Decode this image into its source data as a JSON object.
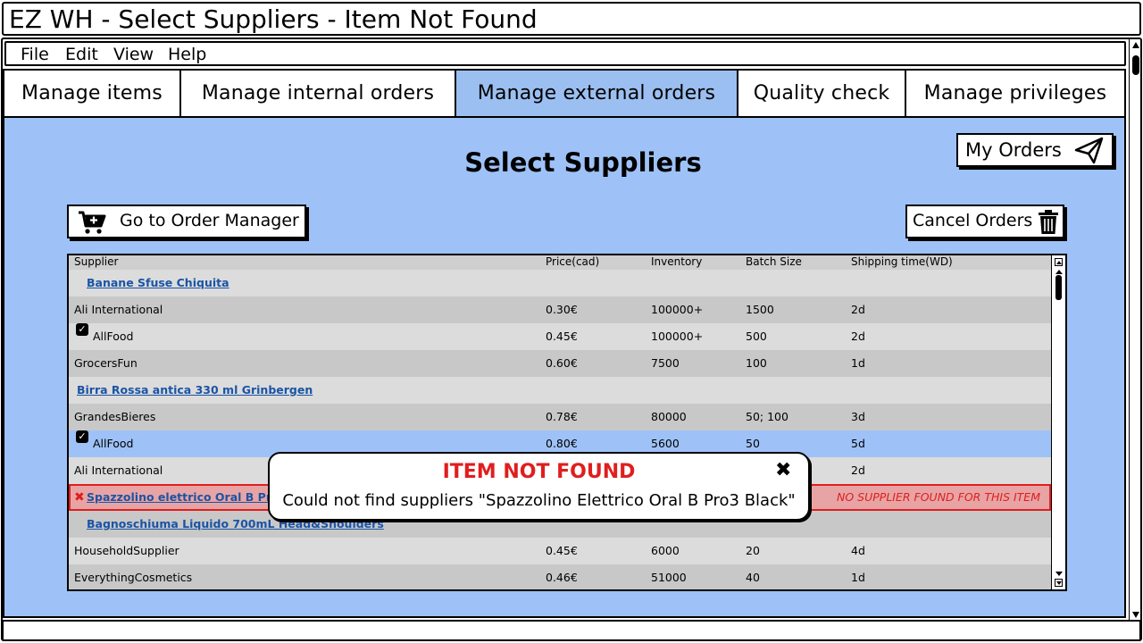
{
  "window_title": "EZ WH - Select Suppliers - Item Not Found",
  "menu": [
    "File",
    "Edit",
    "View",
    "Help"
  ],
  "tabs": [
    {
      "label": "Manage items",
      "active": false
    },
    {
      "label": "Manage internal orders",
      "active": false
    },
    {
      "label": "Manage external orders",
      "active": true
    },
    {
      "label": "Quality check",
      "active": false
    },
    {
      "label": "Manage privileges",
      "active": false
    }
  ],
  "page_title": "Select Suppliers",
  "buttons": {
    "my_orders": "My Orders",
    "go_to_order_manager": "Go to Order Manager",
    "cancel_orders": "Cancel Orders"
  },
  "table": {
    "columns": [
      "Supplier",
      "Price(cad)",
      "Inventory",
      "Batch Size",
      "Shipping time(WD)"
    ],
    "rows": [
      {
        "type": "item",
        "name": "Banane Sfuse Chiquita"
      },
      {
        "type": "supplier",
        "supplier": "Ali International",
        "price": "0.30€",
        "inventory": "100000+",
        "batch": "1500",
        "shipping": "2d",
        "checked": false
      },
      {
        "type": "supplier",
        "supplier": "AllFood",
        "price": "0.45€",
        "inventory": "100000+",
        "batch": "500",
        "shipping": "2d",
        "checked": true
      },
      {
        "type": "supplier",
        "supplier": "GrocersFun",
        "price": "0.60€",
        "inventory": "7500",
        "batch": "100",
        "shipping": "1d",
        "checked": false
      },
      {
        "type": "item",
        "name": "Birra Rossa antica 330 ml Grinbergen"
      },
      {
        "type": "supplier",
        "supplier": "GrandesBieres",
        "price": "0.78€",
        "inventory": "80000",
        "batch": "50; 100",
        "shipping": "3d",
        "checked": false
      },
      {
        "type": "supplier",
        "supplier": "AllFood",
        "price": "0.80€",
        "inventory": "5600",
        "batch": "50",
        "shipping": "5d",
        "checked": true,
        "selected": true
      },
      {
        "type": "supplier",
        "supplier": "Ali International",
        "price": "",
        "inventory": "",
        "batch": "",
        "shipping": "2d",
        "checked": false
      },
      {
        "type": "error",
        "name": "Spazzolino elettrico Oral B Pro3 Black",
        "message": "NO SUPPLIER FOUND FOR THIS ITEM"
      },
      {
        "type": "item",
        "name": "Bagnoschiuma Liquido 700mL Head&Shoulders"
      },
      {
        "type": "supplier",
        "supplier": "HouseholdSupplier",
        "price": "0.45€",
        "inventory": "6000",
        "batch": "20",
        "shipping": "4d",
        "checked": false
      },
      {
        "type": "supplier",
        "supplier": "EverythingCosmetics",
        "price": "0.46€",
        "inventory": "51000",
        "batch": "40",
        "shipping": "1d",
        "checked": false
      }
    ]
  },
  "modal": {
    "title": "ITEM NOT FOUND",
    "message": "Could not find suppliers \"Spazzolino Elettrico Oral B Pro3 Black\"",
    "close_icon": "close-icon"
  },
  "colors": {
    "panel": "#9ec2f7",
    "active_tab": "#9bbff0",
    "error": "#e01e1e",
    "link": "#1a54a6"
  }
}
